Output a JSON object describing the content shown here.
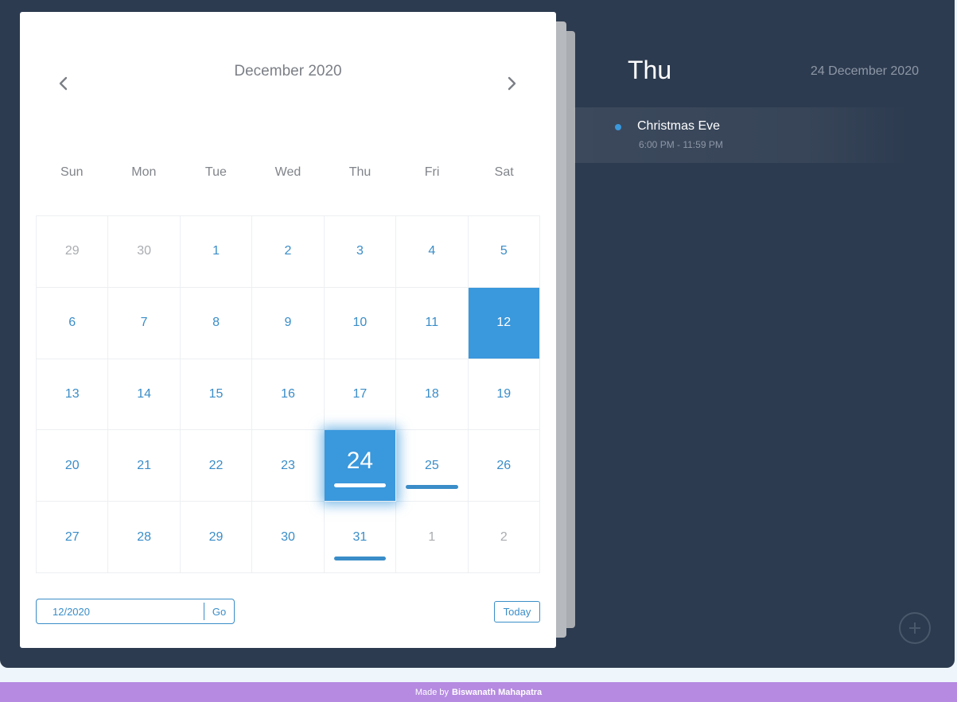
{
  "calendar": {
    "month_title": "December 2020",
    "weekdays": [
      "Sun",
      "Mon",
      "Tue",
      "Wed",
      "Thu",
      "Fri",
      "Sat"
    ],
    "days": [
      {
        "label": "29",
        "muted": true
      },
      {
        "label": "30",
        "muted": true
      },
      {
        "label": "1"
      },
      {
        "label": "2"
      },
      {
        "label": "3"
      },
      {
        "label": "4"
      },
      {
        "label": "5"
      },
      {
        "label": "6"
      },
      {
        "label": "7"
      },
      {
        "label": "8"
      },
      {
        "label": "9"
      },
      {
        "label": "10"
      },
      {
        "label": "11"
      },
      {
        "label": "12",
        "selected": true
      },
      {
        "label": "13"
      },
      {
        "label": "14"
      },
      {
        "label": "15"
      },
      {
        "label": "16"
      },
      {
        "label": "17"
      },
      {
        "label": "18"
      },
      {
        "label": "19"
      },
      {
        "label": "20"
      },
      {
        "label": "21"
      },
      {
        "label": "22"
      },
      {
        "label": "23"
      },
      {
        "label": "24",
        "today": true,
        "event": true
      },
      {
        "label": "25",
        "event": true
      },
      {
        "label": "26"
      },
      {
        "label": "27"
      },
      {
        "label": "28"
      },
      {
        "label": "29"
      },
      {
        "label": "30"
      },
      {
        "label": "31",
        "event": true
      },
      {
        "label": "1",
        "muted": true
      },
      {
        "label": "2",
        "muted": true
      }
    ],
    "date_input_value": "12/2020",
    "go_label": "Go",
    "today_label": "Today"
  },
  "detail": {
    "day_name": "Thu",
    "full_date": "24 December 2020",
    "events": [
      {
        "title": "Christmas Eve",
        "time": "6:00 PM - 11:59 PM"
      }
    ]
  },
  "footer": {
    "prefix": "Made by",
    "author": "Biswanath Mahapatra"
  },
  "colors": {
    "accent": "#3a98dc",
    "background": "#2d3b50",
    "footer": "#b58ae0"
  },
  "icons": {
    "prev": "chevron-left-icon",
    "next": "chevron-right-icon",
    "add": "plus-icon"
  }
}
